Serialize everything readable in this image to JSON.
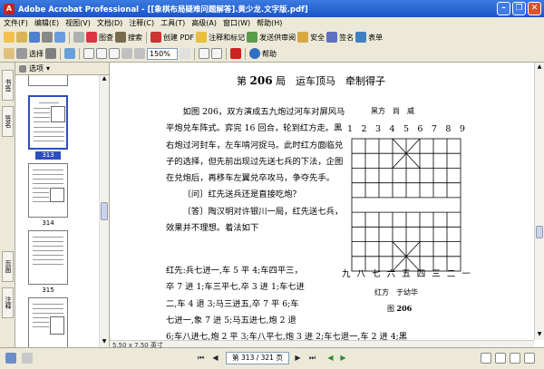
{
  "window": {
    "title": "Adobe Acrobat Professional - [[象棋布局疑难问题解答].黄少龙.文字版.pdf]",
    "app_icon": "acrobat-icon"
  },
  "menu": [
    "文件(F)",
    "编辑(E)",
    "视图(V)",
    "文档(D)",
    "注释(C)",
    "工具(T)",
    "高级(A)",
    "窗口(W)",
    "帮助(H)"
  ],
  "toolbar1": {
    "print_label": "图查",
    "search_label": "搜索",
    "create_pdf": "创建 PDF",
    "review": "注释和标记",
    "send_review": "发送供审阅",
    "secure": "安全",
    "sign": "签名",
    "forms": "表单"
  },
  "toolbar2": {
    "select_label": "选择",
    "zoom": "150%",
    "help": "帮助"
  },
  "sidebar": {
    "tabs": [
      "书签",
      "签名",
      "页面",
      "注释"
    ],
    "options_label": "选项",
    "thumbnails": [
      "",
      "313",
      "314",
      "315",
      ""
    ],
    "selected": "313"
  },
  "document": {
    "heading_prefix": "第",
    "heading_num": "206",
    "heading_suffix": "局　运车顶马　牵制得子",
    "paragraphs": [
      "如图 206，双方演成五九炮过河车对屏风马平炮兑车阵式。弈完 16 回合，轮到红方走。黑右炮过河封车，左车啃河捉马。此时红方面临兑子的选择，但先前出现过先送七兵的下法，企图在兑炮后，再移车左翼兑卒攻马，争夺先手。",
      "〔问〕红先送兵还是直接吃炮？",
      "〔答〕陶汉明对许银川一局，红先送七兵，效果并不理想。着法如下"
    ],
    "moves": [
      "红先:兵七进一,车 5 平 4;车四平三，",
      "卒 7 进 1;车三平七,卒 3 进 1;车七进",
      "二,车 4 退 3;马三进五,卒 7 平 6;车",
      "七进一,象 7 进 5;马五进七,炮 2 退",
      "6;车八进七,炮 2 平 3;车八平七,炮 3 进 2;车七退一,车 2 进 4;黑"
    ],
    "board": {
      "top_label": "黑方　尚　威",
      "top_cols": [
        "1",
        "2",
        "3",
        "4",
        "5",
        "6",
        "7",
        "8",
        "9"
      ],
      "bottom_cols": [
        "九",
        "八",
        "七",
        "六",
        "五",
        "四",
        "三",
        "二",
        "一"
      ],
      "bottom_label": "红方　于幼华",
      "caption_prefix": "图",
      "caption_num": "206"
    }
  },
  "statusbar": {
    "page_size": "5.50 x 7.50 英寸",
    "page_field": "第 313 / 321 页"
  },
  "colors": {
    "titlebar": "#1a55c9",
    "chrome": "#ece9d8",
    "selection": "#2d4fbd"
  }
}
